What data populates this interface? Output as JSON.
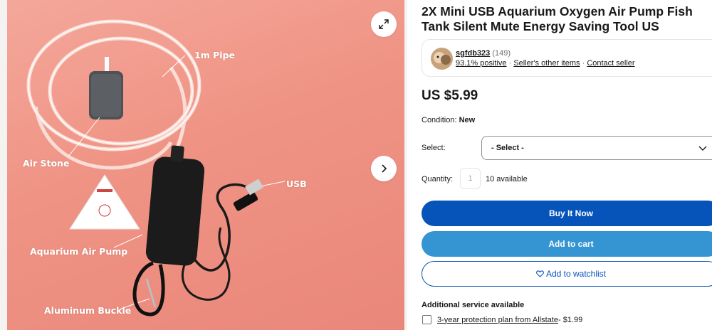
{
  "gallery": {
    "photo_labels": {
      "pipe": "1m Pipe",
      "air_stone": "Air Stone",
      "usb": "USB",
      "pump": "Aquarium Air Pump",
      "buckle": "Aluminum Buckle"
    },
    "expand_icon": "expand-icon",
    "next_icon": "chevron-right-icon"
  },
  "listing": {
    "title": "2X Mini USB Aquarium Oxygen Air Pump Fish Tank Silent Mute Energy Saving Tool US",
    "seller": {
      "name": "sgfdb323",
      "rating_count": "(149)",
      "positive": "93.1% positive",
      "sep1": " · ",
      "other_items": "Seller's other items",
      "sep2": " · ",
      "contact": "Contact seller"
    },
    "price": "US $5.99",
    "condition_label": "Condition:",
    "condition_value": "New",
    "select_label": "Select:",
    "select_value": "- Select -",
    "quantity_label": "Quantity:",
    "quantity_value": "1",
    "available": "10 available",
    "buy_now": "Buy It Now",
    "add_to_cart": "Add to cart",
    "add_to_watchlist": "Add to watchlist",
    "additional_service": "Additional service available",
    "protection_plan": "3-year protection plan from Allstate",
    "protection_price": " - $1.99"
  },
  "colors": {
    "buy_now_bg": "#0654ba",
    "cart_bg": "#3595d2",
    "photo_bg": "#ef9384"
  }
}
